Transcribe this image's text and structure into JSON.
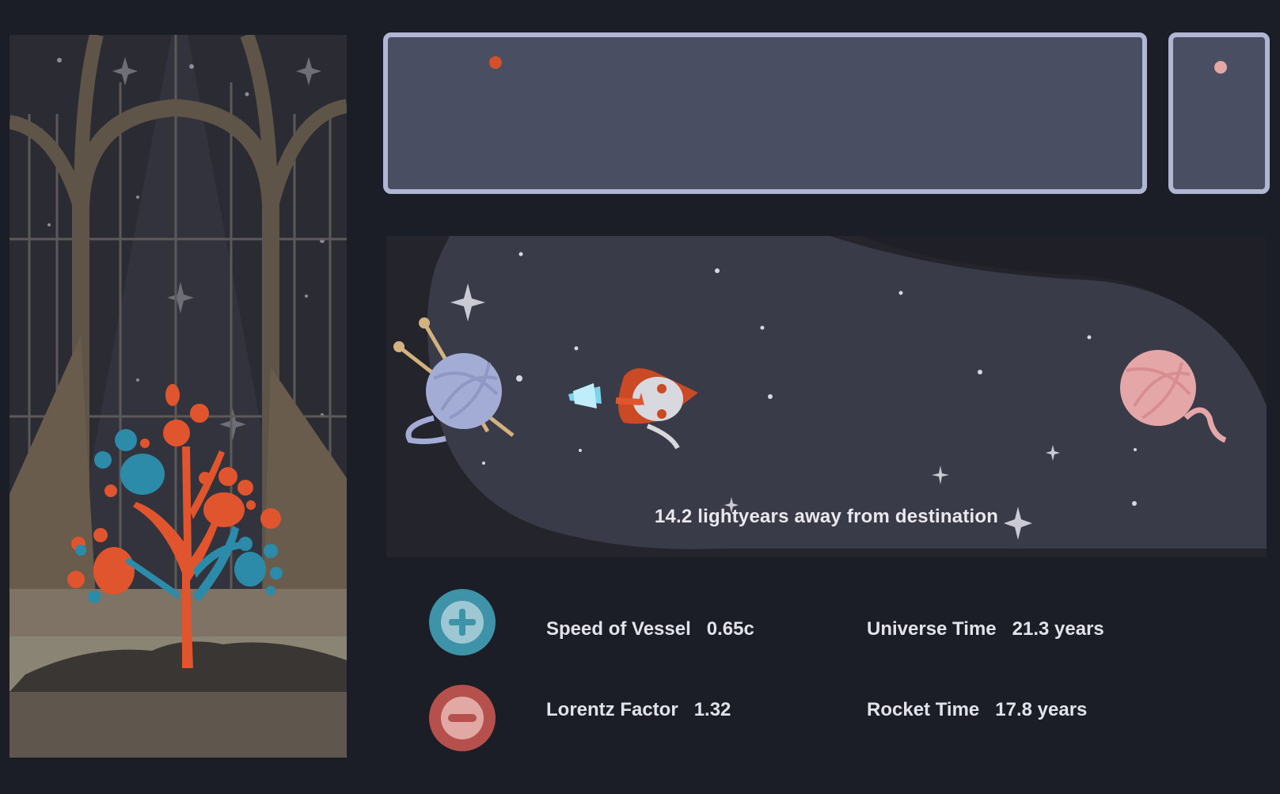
{
  "scene": {
    "distance_text": "14.2 lightyears away from destination"
  },
  "meters": {
    "main_marker_color": "#d4502a",
    "side_marker_color": "#e2a8a4",
    "frame_color": "#b1b6d3",
    "fill_color": "#4a4e63"
  },
  "controls": {
    "increase_icon": "plus-icon",
    "decrease_icon": "minus-icon"
  },
  "stats": {
    "speed_label": "Speed of Vessel",
    "speed_value": "0.65c",
    "lorentz_label": "Lorentz Factor",
    "lorentz_value": "1.32",
    "universe_time_label": "Universe Time",
    "universe_time_value": "21.3 years",
    "rocket_time_label": "Rocket Time",
    "rocket_time_value": "17.8 years"
  },
  "colors": {
    "background": "#1b1d27",
    "yarn_start": "#a3acd4",
    "yarn_destination": "#e5a6a8",
    "tree_orange": "#e0552e",
    "tree_blue": "#2b8ba8"
  }
}
